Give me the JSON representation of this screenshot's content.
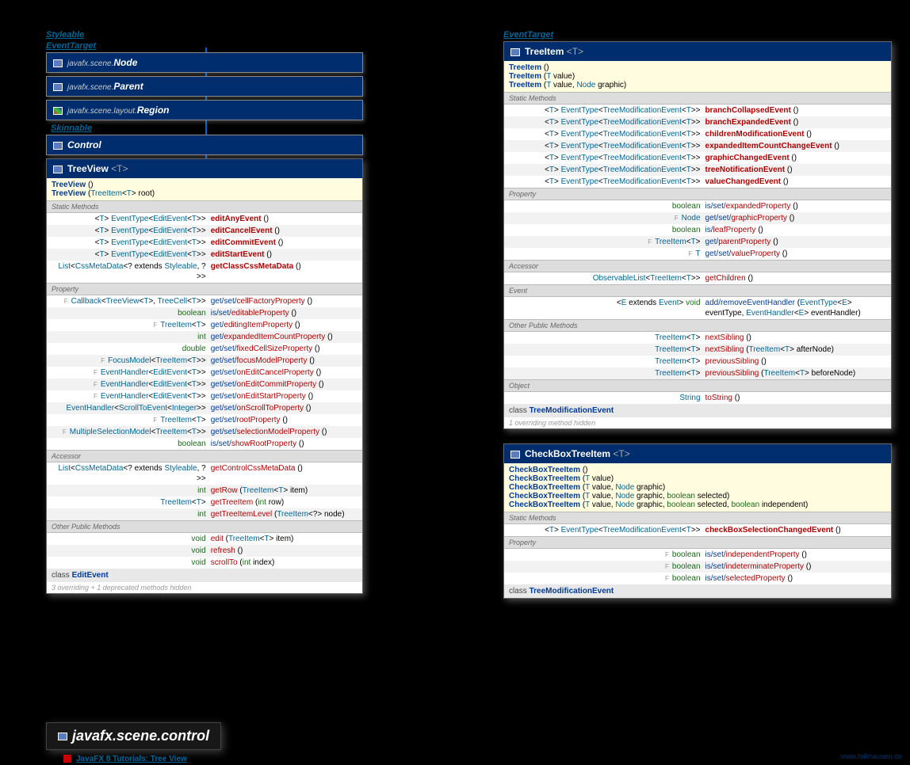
{
  "ifaces": {
    "styleable": "Styleable",
    "eventtarget": "EventTarget",
    "skinnable": "Skinnable"
  },
  "hier": [
    {
      "pkg": "javafx.scene.",
      "cls": "Node"
    },
    {
      "pkg": "javafx.scene.",
      "cls": "Parent"
    },
    {
      "pkg": "javafx.scene.layout.",
      "cls": "Region"
    },
    {
      "pkg": "",
      "cls": "Control"
    }
  ],
  "treeview": {
    "title": "TreeView",
    "gen": "<T>",
    "ctors": [
      {
        "name": "TreeView",
        "args": "()"
      },
      {
        "name": "TreeView",
        "args": "(TreeItem<T> root)"
      }
    ],
    "static": [
      {
        "l": "<T>  EventType<EditEvent<T>>",
        "m": "editAnyEvent",
        "a": "()"
      },
      {
        "l": "<T>  EventType<EditEvent<T>>",
        "m": "editCancelEvent",
        "a": "()"
      },
      {
        "l": "<T>  EventType<EditEvent<T>>",
        "m": "editCommitEvent",
        "a": "()"
      },
      {
        "l": "<T>  EventType<EditEvent<T>>",
        "m": "editStartEvent",
        "a": "()"
      },
      {
        "l": "List<CssMetaData<? extends Styleable, ?>>",
        "m": "getClassCssMetaData",
        "a": "()"
      }
    ],
    "prop": [
      {
        "f": "F",
        "l": "Callback<TreeView<T>, TreeCell<T>>",
        "g": "get/set/",
        "p": "cellFactoryProperty",
        "a": "()"
      },
      {
        "f": "",
        "l": "boolean",
        "g": "is/set/",
        "p": "editableProperty",
        "a": "()"
      },
      {
        "f": "F",
        "l": "TreeItem<T>",
        "g": "get/",
        "p": "editingItemProperty",
        "a": "()"
      },
      {
        "f": "",
        "l": "int",
        "g": "get/",
        "p": "expandedItemCountProperty",
        "a": "()"
      },
      {
        "f": "",
        "l": "double",
        "g": "get/set/",
        "p": "fixedCellSizeProperty",
        "a": "()"
      },
      {
        "f": "F",
        "l": "FocusModel<TreeItem<T>>",
        "g": "get/set/",
        "p": "focusModelProperty",
        "a": "()"
      },
      {
        "f": "F",
        "l": "EventHandler<EditEvent<T>>",
        "g": "get/set/",
        "p": "onEditCancelProperty",
        "a": "()"
      },
      {
        "f": "F",
        "l": "EventHandler<EditEvent<T>>",
        "g": "get/set/",
        "p": "onEditCommitProperty",
        "a": "()"
      },
      {
        "f": "F",
        "l": "EventHandler<EditEvent<T>>",
        "g": "get/set/",
        "p": "onEditStartProperty",
        "a": "()"
      },
      {
        "f": "",
        "l": "EventHandler<ScrollToEvent<Integer>>",
        "g": "get/set/",
        "p": "onScrollToProperty",
        "a": "()"
      },
      {
        "f": "F",
        "l": "TreeItem<T>",
        "g": "get/set/",
        "p": "rootProperty",
        "a": "()"
      },
      {
        "f": "F",
        "l": "MultipleSelectionModel<TreeItem<T>>",
        "g": "get/set/",
        "p": "selectionModelProperty",
        "a": "()"
      },
      {
        "f": "",
        "l": "boolean",
        "g": "is/set/",
        "p": "showRootProperty",
        "a": "()"
      }
    ],
    "acc": [
      {
        "l": "List<CssMetaData<? extends Styleable, ?>>",
        "m": "getControlCssMetaData",
        "a": "()"
      },
      {
        "l": "int",
        "m": "getRow",
        "a": "(TreeItem<T> item)"
      },
      {
        "l": "TreeItem<T>",
        "m": "getTreeItem",
        "a": "(int row)"
      },
      {
        "l": "int",
        "m": "getTreeItemLevel",
        "a": "(TreeItem<?> node)"
      }
    ],
    "opm": [
      {
        "l": "void",
        "m": "edit",
        "a": "(TreeItem<T> item)"
      },
      {
        "l": "void",
        "m": "refresh",
        "a": "()"
      },
      {
        "l": "void",
        "m": "scrollTo",
        "a": "(int index)"
      }
    ],
    "footcls": "EditEvent",
    "hidden": "3 overriding + 1 deprecated methods hidden"
  },
  "treeitem": {
    "title": "TreeItem",
    "gen": "<T>",
    "ctors": [
      {
        "name": "TreeItem",
        "args": "()"
      },
      {
        "name": "TreeItem",
        "args": "(T value)"
      },
      {
        "name": "TreeItem",
        "args": "(T value, Node graphic)"
      }
    ],
    "static": [
      {
        "l": "<T>  EventType<TreeModificationEvent<T>>",
        "m": "branchCollapsedEvent",
        "a": "()"
      },
      {
        "l": "<T>  EventType<TreeModificationEvent<T>>",
        "m": "branchExpandedEvent",
        "a": "()"
      },
      {
        "l": "<T>  EventType<TreeModificationEvent<T>>",
        "m": "childrenModificationEvent",
        "a": "()"
      },
      {
        "l": "<T>  EventType<TreeModificationEvent<T>>",
        "m": "expandedItemCountChangeEvent",
        "a": "()"
      },
      {
        "l": "<T>  EventType<TreeModificationEvent<T>>",
        "m": "graphicChangedEvent",
        "a": "()"
      },
      {
        "l": "<T>  EventType<TreeModificationEvent<T>>",
        "m": "treeNotificationEvent",
        "a": "()"
      },
      {
        "l": "<T>  EventType<TreeModificationEvent<T>>",
        "m": "valueChangedEvent",
        "a": "()"
      }
    ],
    "prop": [
      {
        "f": "",
        "l": "boolean",
        "g": "is/set/",
        "p": "expandedProperty",
        "a": "()"
      },
      {
        "f": "F",
        "l": "Node",
        "g": "get/set/",
        "p": "graphicProperty",
        "a": "()"
      },
      {
        "f": "",
        "l": "boolean",
        "g": "is/",
        "p": "leafProperty",
        "a": "()"
      },
      {
        "f": "F",
        "l": "TreeItem<T>",
        "g": "get/",
        "p": "parentProperty",
        "a": "()"
      },
      {
        "f": "F",
        "l": "T",
        "g": "get/set/",
        "p": "valueProperty",
        "a": "()"
      }
    ],
    "acc": [
      {
        "l": "ObservableList<TreeItem<T>>",
        "m": "getChildren",
        "a": "()"
      }
    ],
    "evt": [
      {
        "l": "<E extends Event>  void",
        "m": "add/removeEventHandler",
        "a": "(EventType<E> eventType, EventHandler<E> eventHandler)"
      }
    ],
    "opm": [
      {
        "l": "TreeItem<T>",
        "m": "nextSibling",
        "a": "()"
      },
      {
        "l": "TreeItem<T>",
        "m": "nextSibling",
        "a": "(TreeItem<T> afterNode)"
      },
      {
        "l": "TreeItem<T>",
        "m": "previousSibling",
        "a": "()"
      },
      {
        "l": "TreeItem<T>",
        "m": "previousSibling",
        "a": "(TreeItem<T> beforeNode)"
      }
    ],
    "obj": [
      {
        "l": "String",
        "m": "toString",
        "a": "()"
      }
    ],
    "footcls": "TreeModificationEvent",
    "hidden": "1 overriding method hidden"
  },
  "cbtree": {
    "title": "CheckBoxTreeItem",
    "gen": "<T>",
    "ctors": [
      {
        "name": "CheckBoxTreeItem",
        "args": "()"
      },
      {
        "name": "CheckBoxTreeItem",
        "args": "(T value)"
      },
      {
        "name": "CheckBoxTreeItem",
        "args": "(T value, Node graphic)"
      },
      {
        "name": "CheckBoxTreeItem",
        "args": "(T value, Node graphic, boolean selected)"
      },
      {
        "name": "CheckBoxTreeItem",
        "args": "(T value, Node graphic, boolean selected, boolean independent)"
      }
    ],
    "static": [
      {
        "l": "<T>  EventType<TreeModificationEvent<T>>",
        "m": "checkBoxSelectionChangedEvent",
        "a": "()"
      }
    ],
    "prop": [
      {
        "f": "F",
        "l": "boolean",
        "g": "is/set/",
        "p": "independentProperty",
        "a": "()"
      },
      {
        "f": "F",
        "l": "boolean",
        "g": "is/set/",
        "p": "indeterminateProperty",
        "a": "()"
      },
      {
        "f": "F",
        "l": "boolean",
        "g": "is/set/",
        "p": "selectedProperty",
        "a": "()"
      }
    ],
    "footcls": "TreeModificationEvent"
  },
  "pkg": "javafx.scene.control",
  "tut": "JavaFX 8 Tutorials: Tree View",
  "site": "www.falkhausen.de",
  "sectLabels": {
    "static": "Static Methods",
    "prop": "Property",
    "acc": "Accessor",
    "evt": "Event",
    "opm": "Other Public Methods",
    "obj": "Object"
  }
}
